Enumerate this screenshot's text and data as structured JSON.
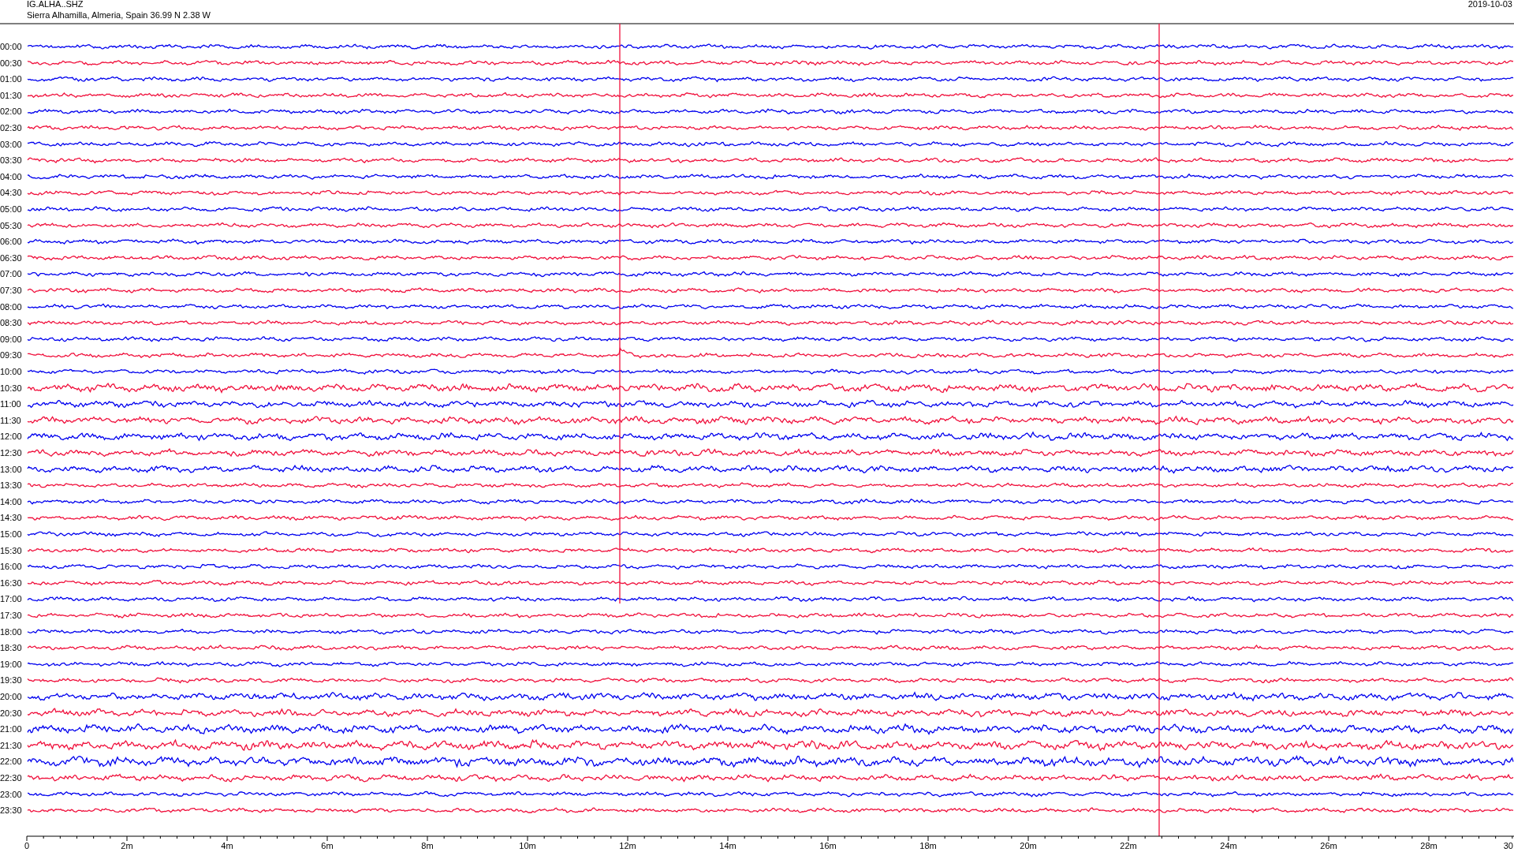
{
  "header": {
    "station": "IG.ALHA..SHZ",
    "location": "Sierra Alhamilla, Almeria, Spain  36.99 N 2.38 W",
    "date": "2019-10-03"
  },
  "rows": [
    {
      "label": "00:00",
      "color": "#0000ee"
    },
    {
      "label": "00:30",
      "color": "#f0103c"
    },
    {
      "label": "01:00",
      "color": "#0000ee"
    },
    {
      "label": "01:30",
      "color": "#f0103c"
    },
    {
      "label": "02:00",
      "color": "#0000ee"
    },
    {
      "label": "02:30",
      "color": "#f0103c"
    },
    {
      "label": "03:00",
      "color": "#0000ee"
    },
    {
      "label": "03:30",
      "color": "#f0103c"
    },
    {
      "label": "04:00",
      "color": "#0000ee"
    },
    {
      "label": "04:30",
      "color": "#f0103c"
    },
    {
      "label": "05:00",
      "color": "#0000ee"
    },
    {
      "label": "05:30",
      "color": "#f0103c"
    },
    {
      "label": "06:00",
      "color": "#0000ee"
    },
    {
      "label": "06:30",
      "color": "#f0103c"
    },
    {
      "label": "07:00",
      "color": "#0000ee"
    },
    {
      "label": "07:30",
      "color": "#f0103c"
    },
    {
      "label": "08:00",
      "color": "#0000ee"
    },
    {
      "label": "08:30",
      "color": "#f0103c"
    },
    {
      "label": "09:00",
      "color": "#0000ee"
    },
    {
      "label": "09:30",
      "color": "#f0103c"
    },
    {
      "label": "10:00",
      "color": "#0000ee"
    },
    {
      "label": "10:30",
      "color": "#f0103c"
    },
    {
      "label": "11:00",
      "color": "#0000ee"
    },
    {
      "label": "11:30",
      "color": "#f0103c"
    },
    {
      "label": "12:00",
      "color": "#0000ee"
    },
    {
      "label": "12:30",
      "color": "#f0103c"
    },
    {
      "label": "13:00",
      "color": "#0000ee"
    },
    {
      "label": "13:30",
      "color": "#f0103c"
    },
    {
      "label": "14:00",
      "color": "#0000ee"
    },
    {
      "label": "14:30",
      "color": "#f0103c"
    },
    {
      "label": "15:00",
      "color": "#0000ee"
    },
    {
      "label": "15:30",
      "color": "#f0103c"
    },
    {
      "label": "16:00",
      "color": "#0000ee"
    },
    {
      "label": "16:30",
      "color": "#f0103c"
    },
    {
      "label": "17:00",
      "color": "#0000ee"
    },
    {
      "label": "17:30",
      "color": "#f0103c"
    },
    {
      "label": "18:00",
      "color": "#0000ee"
    },
    {
      "label": "18:30",
      "color": "#f0103c"
    },
    {
      "label": "19:00",
      "color": "#0000ee"
    },
    {
      "label": "19:30",
      "color": "#f0103c"
    },
    {
      "label": "20:00",
      "color": "#0000ee"
    },
    {
      "label": "20:30",
      "color": "#f0103c"
    },
    {
      "label": "21:00",
      "color": "#0000ee"
    },
    {
      "label": "21:30",
      "color": "#f0103c"
    },
    {
      "label": "22:00",
      "color": "#0000ee"
    },
    {
      "label": "22:30",
      "color": "#f0103c"
    },
    {
      "label": "23:00",
      "color": "#0000ee"
    },
    {
      "label": "23:30",
      "color": "#f0103c"
    }
  ],
  "axis_ticks": [
    "0",
    "2m",
    "4m",
    "6m",
    "8m",
    "10m",
    "12m",
    "14m",
    "16m",
    "18m",
    "20m",
    "22m",
    "24m",
    "26m",
    "28m",
    "30"
  ]
}
